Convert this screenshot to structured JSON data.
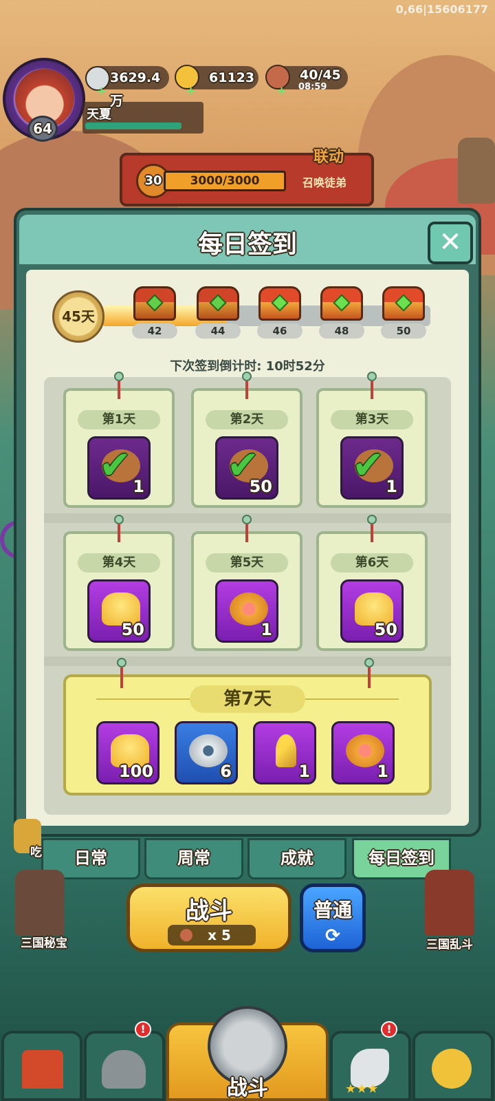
{
  "debug": "0,66|15606177",
  "player": {
    "level": "64",
    "name": "天夏"
  },
  "resources": [
    {
      "icon": "silver-coin-icon",
      "value": "3629.4万"
    },
    {
      "icon": "gold-ingot-icon",
      "value": "61123"
    },
    {
      "icon": "meat-icon",
      "value": "40/45",
      "timer": "08:59"
    }
  ],
  "event": {
    "level": "30",
    "progress": "3000/3000",
    "label": "召唤徒弟",
    "tag": "联动"
  },
  "modal": {
    "title": "每日签到",
    "days_badge": "45天",
    "progress_fraction": 0.38,
    "chests": [
      {
        "day": "42",
        "claimed": true
      },
      {
        "day": "44",
        "claimed": true
      },
      {
        "day": "46",
        "claimed": false
      },
      {
        "day": "48",
        "claimed": false
      },
      {
        "day": "50",
        "claimed": false
      }
    ],
    "countdown": "下次签到倒计时: 10时52分",
    "days": [
      {
        "label": "第1天",
        "icon": "check-icon",
        "qty": "1",
        "claimed": true
      },
      {
        "label": "第2天",
        "icon": "check-icon",
        "qty": "50",
        "claimed": true
      },
      {
        "label": "第3天",
        "icon": "check-icon",
        "qty": "1",
        "claimed": true
      },
      {
        "label": "第4天",
        "icon": "gold-ingot-icon",
        "qty": "50",
        "claimed": false
      },
      {
        "label": "第5天",
        "icon": "heart-coin-icon",
        "qty": "1",
        "claimed": false
      },
      {
        "label": "第6天",
        "icon": "gold-ingot-icon",
        "qty": "50",
        "claimed": false
      }
    ],
    "day7": {
      "label": "第7天",
      "rewards": [
        {
          "icon": "gold-ingot-icon",
          "qty": "100"
        },
        {
          "icon": "silver-coin-icon",
          "qty": "6"
        },
        {
          "icon": "key-icon",
          "qty": "1"
        },
        {
          "icon": "heart-coin-icon",
          "qty": "1"
        }
      ]
    }
  },
  "tabs": [
    "日常",
    "周常",
    "成就",
    "每日签到"
  ],
  "active_tab": "每日签到",
  "battle": {
    "label": "战斗",
    "cost": "x 5",
    "mode": "普通"
  },
  "side_labels": {
    "left": "三国秘宝",
    "right": "三国乱斗",
    "left_top": "吃"
  },
  "nav": {
    "center_label": "战斗"
  },
  "colors": {
    "accent": "#3c6f63",
    "gold": "#f0b22a",
    "purple": "#8b2fc9",
    "active_tab": "#78d49a"
  }
}
